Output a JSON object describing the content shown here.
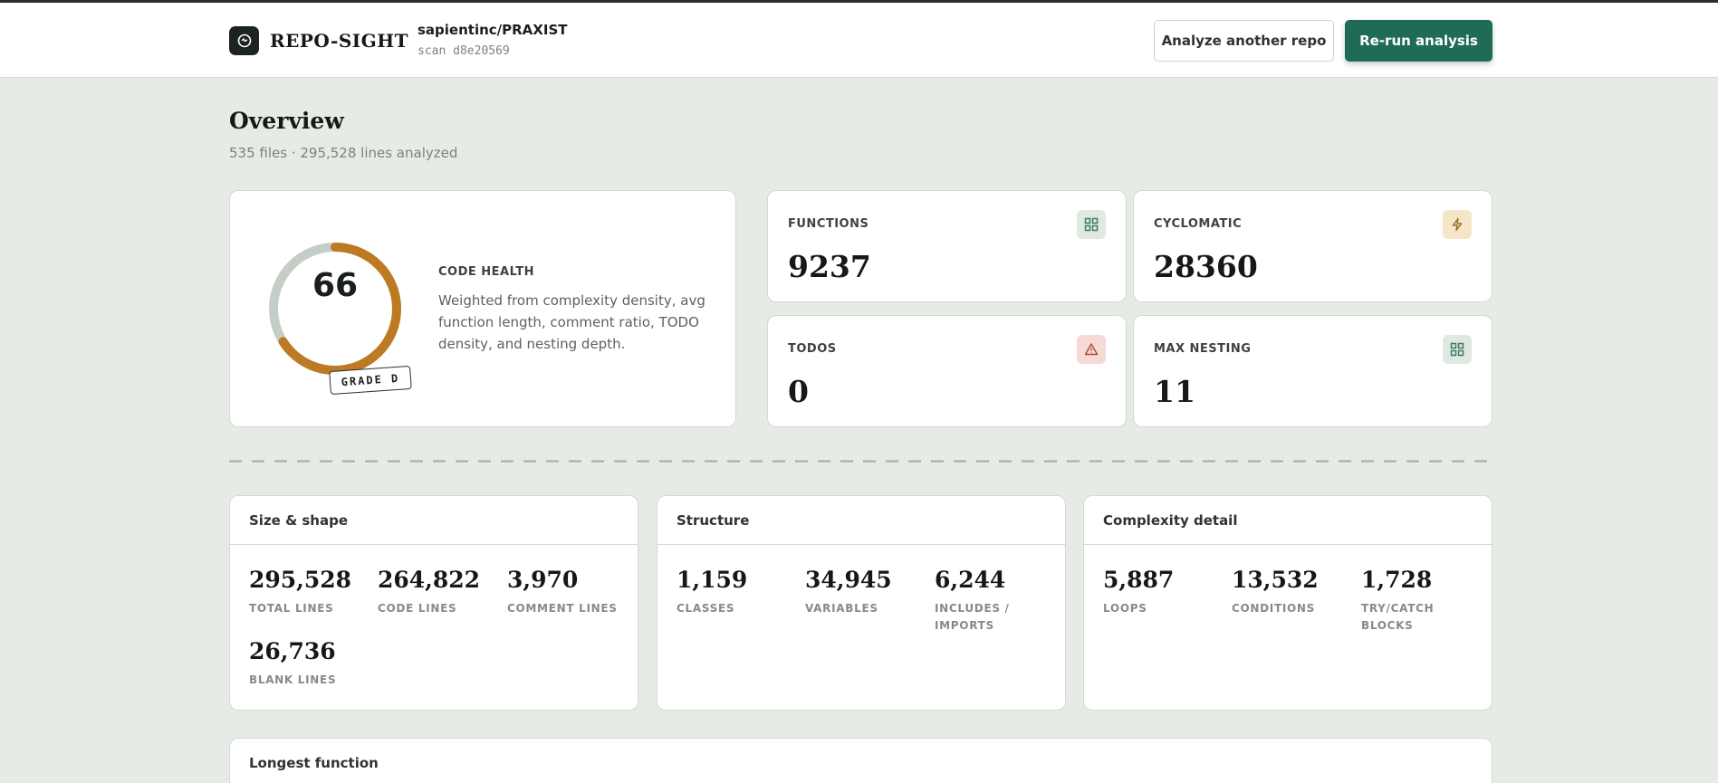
{
  "header": {
    "brand": "REPO-SIGHT",
    "repo_name": "sapientinc/PRAXIST",
    "scan": "scan d8e20569",
    "btn_analyze": "Analyze another repo",
    "btn_rerun": "Re-run analysis"
  },
  "overview": {
    "title": "Overview",
    "subtitle": "535 files · 295,528 lines analyzed"
  },
  "health": {
    "score": "66",
    "score_fraction": 0.66,
    "grade": "GRADE D",
    "label": "CODE HEALTH",
    "description": "Weighted from complexity density, avg function length, comment ratio, TODO density, and nesting depth.",
    "colors": {
      "arc": "#bd7a22",
      "track": "#c5cec6"
    }
  },
  "stats": [
    {
      "label": "FUNCTIONS",
      "value": "9237",
      "icon": "grid-icon"
    },
    {
      "label": "CYCLOMATIC",
      "value": "28360",
      "icon": "lightning-icon"
    },
    {
      "label": "TODOS",
      "value": "0",
      "icon": "warning-icon"
    },
    {
      "label": "MAX NESTING",
      "value": "11",
      "icon": "grid-icon"
    }
  ],
  "panels": {
    "size": {
      "title": "Size & shape",
      "metrics": [
        {
          "value": "295,528",
          "label": "TOTAL LINES"
        },
        {
          "value": "264,822",
          "label": "CODE LINES"
        },
        {
          "value": "3,970",
          "label": "COMMENT LINES"
        },
        {
          "value": "26,736",
          "label": "BLANK LINES"
        }
      ]
    },
    "structure": {
      "title": "Structure",
      "metrics": [
        {
          "value": "1,159",
          "label": "CLASSES"
        },
        {
          "value": "34,945",
          "label": "VARIABLES"
        },
        {
          "value": "6,244",
          "label": "INCLUDES / IMPORTS"
        }
      ]
    },
    "complexity": {
      "title": "Complexity detail",
      "metrics": [
        {
          "value": "5,887",
          "label": "LOOPS"
        },
        {
          "value": "13,532",
          "label": "CONDITIONS"
        },
        {
          "value": "1,728",
          "label": "TRY/CATCH BLOCKS"
        }
      ]
    },
    "longest": {
      "title": "Longest function"
    }
  },
  "colors": {
    "accent": "#1f6b57",
    "background": "#e6ebe5"
  }
}
